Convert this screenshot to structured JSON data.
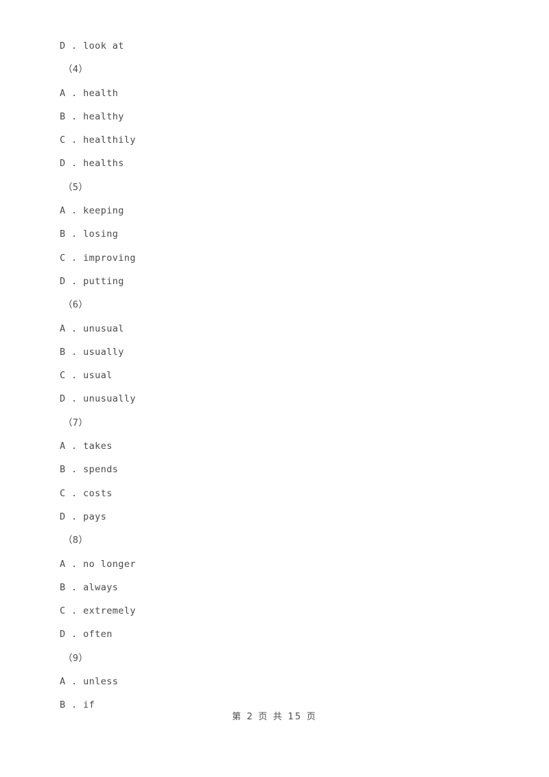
{
  "document": {
    "page_background": "#ffffff",
    "text_color": "#4a4a4a",
    "separator": " . "
  },
  "blocks": [
    {
      "kind": "choice",
      "letter": "D",
      "text": "look at"
    },
    {
      "kind": "question",
      "label": "（4）"
    },
    {
      "kind": "choice",
      "letter": "A",
      "text": "health"
    },
    {
      "kind": "choice",
      "letter": "B",
      "text": "healthy"
    },
    {
      "kind": "choice",
      "letter": "C",
      "text": "healthily"
    },
    {
      "kind": "choice",
      "letter": "D",
      "text": "healths"
    },
    {
      "kind": "question",
      "label": "（5）"
    },
    {
      "kind": "choice",
      "letter": "A",
      "text": "keeping"
    },
    {
      "kind": "choice",
      "letter": "B",
      "text": "losing"
    },
    {
      "kind": "choice",
      "letter": "C",
      "text": "improving"
    },
    {
      "kind": "choice",
      "letter": "D",
      "text": "putting"
    },
    {
      "kind": "question",
      "label": "（6）"
    },
    {
      "kind": "choice",
      "letter": "A",
      "text": "unusual"
    },
    {
      "kind": "choice",
      "letter": "B",
      "text": "usually"
    },
    {
      "kind": "choice",
      "letter": "C",
      "text": "usual"
    },
    {
      "kind": "choice",
      "letter": "D",
      "text": "unusually"
    },
    {
      "kind": "question",
      "label": "（7）"
    },
    {
      "kind": "choice",
      "letter": "A",
      "text": "takes"
    },
    {
      "kind": "choice",
      "letter": "B",
      "text": "spends"
    },
    {
      "kind": "choice",
      "letter": "C",
      "text": "costs"
    },
    {
      "kind": "choice",
      "letter": "D",
      "text": "pays"
    },
    {
      "kind": "question",
      "label": "（8）"
    },
    {
      "kind": "choice",
      "letter": "A",
      "text": "no longer"
    },
    {
      "kind": "choice",
      "letter": "B",
      "text": "always"
    },
    {
      "kind": "choice",
      "letter": "C",
      "text": "extremely"
    },
    {
      "kind": "choice",
      "letter": "D",
      "text": "often"
    },
    {
      "kind": "question",
      "label": "（9）"
    },
    {
      "kind": "choice",
      "letter": "A",
      "text": "unless"
    },
    {
      "kind": "choice",
      "letter": "B",
      "text": "if"
    }
  ],
  "footer": {
    "text": "第 2 页 共 15 页",
    "current_page": 2,
    "total_pages": 15
  }
}
